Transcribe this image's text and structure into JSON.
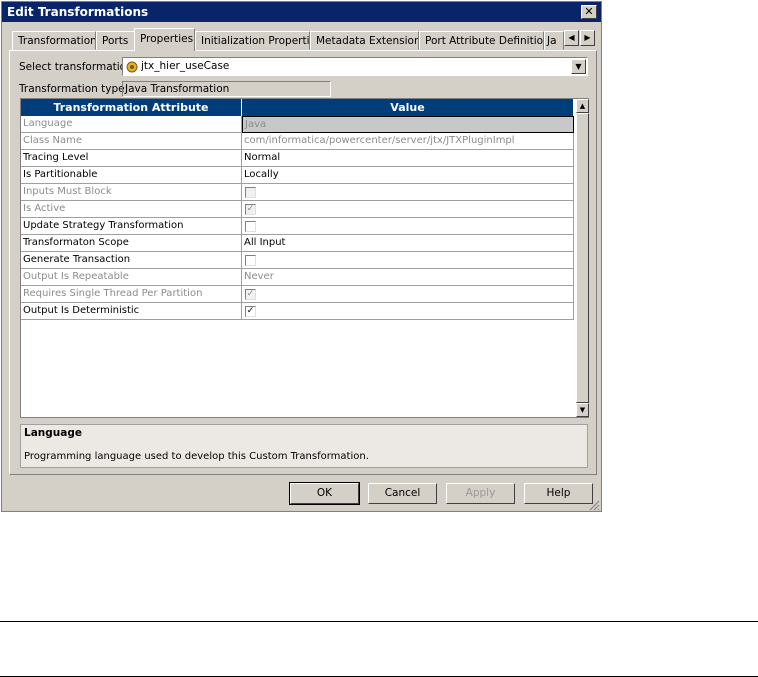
{
  "window": {
    "title": "Edit Transformations",
    "close_glyph": "✕"
  },
  "tabs": [
    {
      "label": "Transformation"
    },
    {
      "label": "Ports"
    },
    {
      "label": "Properties",
      "active": true
    },
    {
      "label": "Initialization Properties"
    },
    {
      "label": "Metadata Extensions"
    },
    {
      "label": "Port Attribute Definitions"
    },
    {
      "label": "Ja"
    }
  ],
  "form": {
    "select_label": "Select transformation:",
    "selected_transformation": "jtx_hier_useCase",
    "type_label": "Transformation type:",
    "type_value": "Java Transformation"
  },
  "grid": {
    "headers": [
      "Transformation Attribute",
      "Value"
    ],
    "rows": [
      {
        "attribute": "Language",
        "value": "Java",
        "enabled": false,
        "kind": "text",
        "selected": true
      },
      {
        "attribute": "Class Name",
        "value": "com/informatica/powercenter/server/jtx/JTXPluginImpl",
        "enabled": false,
        "kind": "text"
      },
      {
        "attribute": "Tracing Level",
        "value": "Normal",
        "enabled": true,
        "kind": "text"
      },
      {
        "attribute": "Is Partitionable",
        "value": "Locally",
        "enabled": true,
        "kind": "text"
      },
      {
        "attribute": "Inputs Must Block",
        "checked": false,
        "enabled": false,
        "kind": "checkbox"
      },
      {
        "attribute": "Is Active",
        "checked": true,
        "enabled": false,
        "kind": "checkbox"
      },
      {
        "attribute": "Update Strategy Transformation",
        "checked": false,
        "enabled": true,
        "kind": "checkbox"
      },
      {
        "attribute": "Transformaton Scope",
        "value": "All Input",
        "enabled": true,
        "kind": "text"
      },
      {
        "attribute": "Generate Transaction",
        "checked": false,
        "enabled": true,
        "kind": "checkbox"
      },
      {
        "attribute": "Output Is Repeatable",
        "value": "Never",
        "enabled": false,
        "kind": "text"
      },
      {
        "attribute": "Requires Single Thread Per Partition",
        "checked": true,
        "enabled": false,
        "kind": "checkbox"
      },
      {
        "attribute": "Output Is Deterministic",
        "checked": true,
        "enabled": true,
        "kind": "checkbox"
      }
    ]
  },
  "description": {
    "title": "Language",
    "text": "Programming language used to develop this Custom Transformation."
  },
  "buttons": {
    "ok": "OK",
    "cancel": "Cancel",
    "apply": "Apply",
    "help": "Help"
  },
  "icons": {
    "transformation": "java-transformation-icon",
    "check_glyph": "✓"
  }
}
